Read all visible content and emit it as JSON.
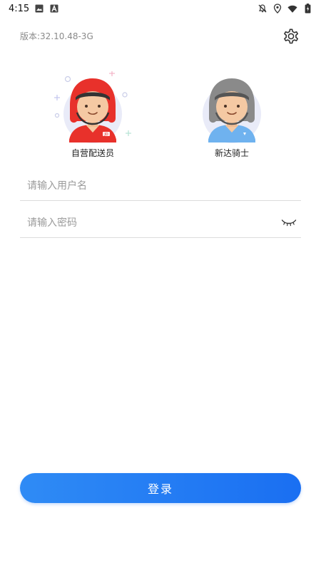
{
  "status_bar": {
    "time": "4:15",
    "icons": [
      "image-icon",
      "app-a-icon",
      "notifications-off-icon",
      "location-icon",
      "wifi-icon",
      "battery-icon"
    ]
  },
  "header": {
    "version_text": "版本:32.10.48-3G",
    "settings_icon": "gear-icon"
  },
  "roles": [
    {
      "label": "自营配送员",
      "helmet_color": "#e8312b",
      "shirt_color": "#e8312b",
      "badge": "JD"
    },
    {
      "label": "新达骑士",
      "helmet_color": "#8a8a8a",
      "shirt_color": "#6fb2ef",
      "badge": ""
    }
  ],
  "form": {
    "username_placeholder": "请输入用户名",
    "password_placeholder": "请输入密码",
    "eye_icon": "eye-closed-icon"
  },
  "login": {
    "label": "登录",
    "color_start": "#2f8bf5",
    "color_end": "#1a6ff2"
  }
}
